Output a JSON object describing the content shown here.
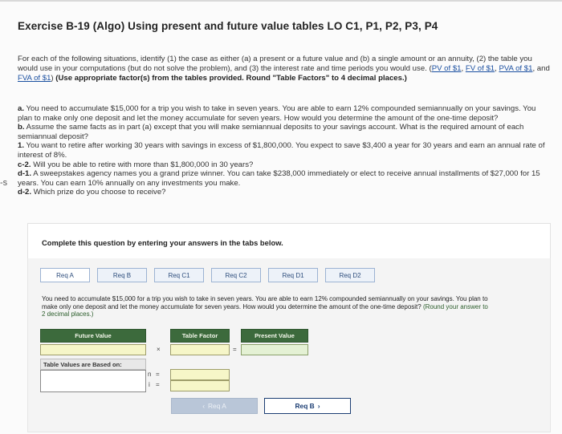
{
  "title": "Exercise B-19 (Algo) Using present and future value tables LO C1, P1, P2, P3, P4",
  "left_mark": "-s",
  "intro": {
    "text_1": "For each of the following situations, identify (1) the case as either (a) a present or a future value and (b) a single amount or an annuity, (2) the table you would use in your computations (but do not solve the problem), and (3) the interest rate and time periods you would use.",
    "link_pv": "PV of $1",
    "link_fv": "FV of $1",
    "link_pva": "PVA of $1",
    "link_fva": "FVA of $1",
    "text_and": "and",
    "bold_instruction": "(Use appropriate factor(s) from the tables provided. Round \"Table Factors\" to 4 decimal places.)"
  },
  "parts": {
    "a_label": "a.",
    "a_text": "You need to accumulate $15,000 for a trip you wish to take in seven years. You are able to earn 12% compounded semiannually on your savings. You plan to make only one deposit and let the money accumulate for seven years. How would you determine the amount of the one-time deposit?",
    "b_label": "b.",
    "b_text": "Assume the same facts as in part (a) except that you will make semiannual deposits to your savings account. What is the required amount of each semiannual deposit?",
    "c1_label": "1.",
    "c1_text": "You want to retire after working 30 years with savings in excess of $1,800,000. You expect to save $3,400 a year for 30 years and earn an annual rate of interest of 8%.",
    "c2_label": "c-2.",
    "c2_text": "Will you be able to retire with more than $1,800,000 in 30 years?",
    "d1_label": "d-1.",
    "d1_text": "A sweepstakes agency names you a grand prize winner. You can take $238,000 immediately or elect to receive annual installments of $27,000 for 15 years. You can earn 10% annually on any investments you make.",
    "d2_label": "d-2.",
    "d2_text": "Which prize do you choose to receive?"
  },
  "card": {
    "text": "Complete this question by entering your answers in the tabs below."
  },
  "tabs": [
    "Req A",
    "Req B",
    "Req C1",
    "Req C2",
    "Req D1",
    "Req D2"
  ],
  "question": {
    "text": "You need to accumulate $15,000 for a trip you wish to take in seven years. You are able to earn 12% compounded semiannually on your savings. You plan to make only one deposit and let the money accumulate for seven years. How would you determine the amount of the one-time deposit?",
    "note": "(Round your answer to 2 decimal places.)"
  },
  "table": {
    "col_future_value": "Future Value",
    "col_table_factor": "Table Factor",
    "col_present_value": "Present Value",
    "op_times": "×",
    "op_equals": "=",
    "based_on": "Table Values are Based on:",
    "n_label": "n",
    "i_label": "i"
  },
  "nav": {
    "prev": "Req A",
    "next": "Req B",
    "prev_arrow": "‹",
    "next_arrow": "›"
  }
}
